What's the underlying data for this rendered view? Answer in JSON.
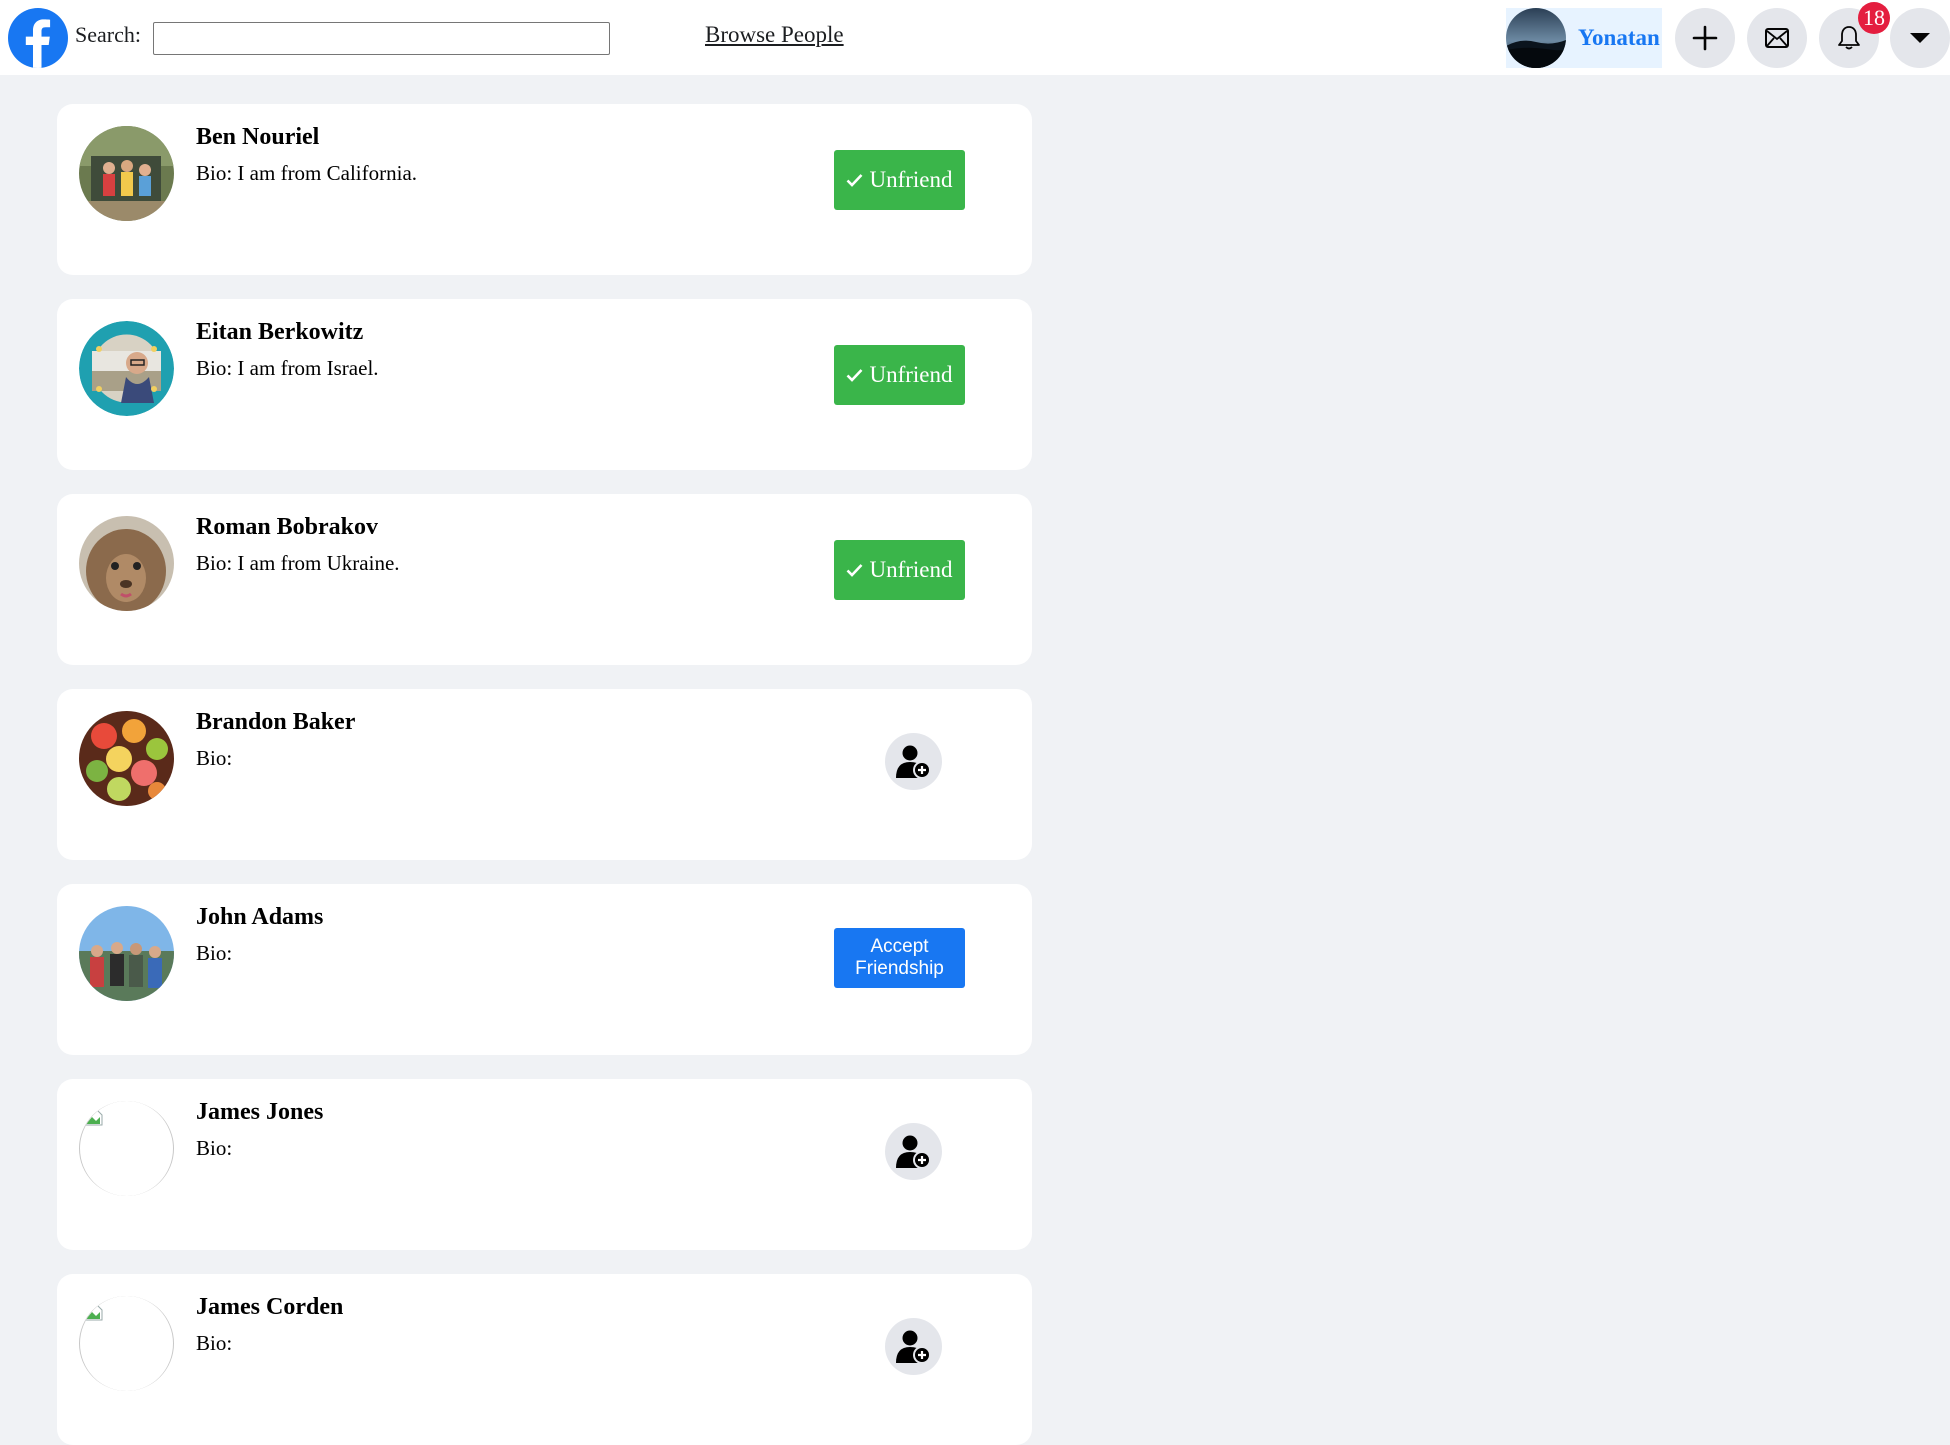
{
  "header": {
    "search_label": "Search:",
    "search_value": "",
    "browse_link": "Browse People",
    "user_name": "Yonatan",
    "notification_count": "18",
    "brand_color": "#1877f2"
  },
  "people": [
    {
      "name": "Ben Nouriel",
      "bio": "Bio: I am from California.",
      "action": "Unfriend"
    },
    {
      "name": "Eitan Berkowitz",
      "bio": "Bio: I am from Israel.",
      "action": "Unfriend"
    },
    {
      "name": "Roman Bobrakov",
      "bio": "Bio: I am from Ukraine.",
      "action": "Unfriend"
    },
    {
      "name": "Brandon Baker",
      "bio": "Bio:",
      "action": "add-friend-icon"
    },
    {
      "name": "John Adams",
      "bio": "Bio:",
      "action": "Accept Friendship"
    },
    {
      "name": "James Jones",
      "bio": "Bio:",
      "action": "add-friend-icon"
    },
    {
      "name": "James Corden",
      "bio": "Bio:",
      "action": "add-friend-icon"
    }
  ],
  "colors": {
    "unfriend": "#3ab54a",
    "accept": "#1877f2",
    "badge": "#e41e3f"
  }
}
